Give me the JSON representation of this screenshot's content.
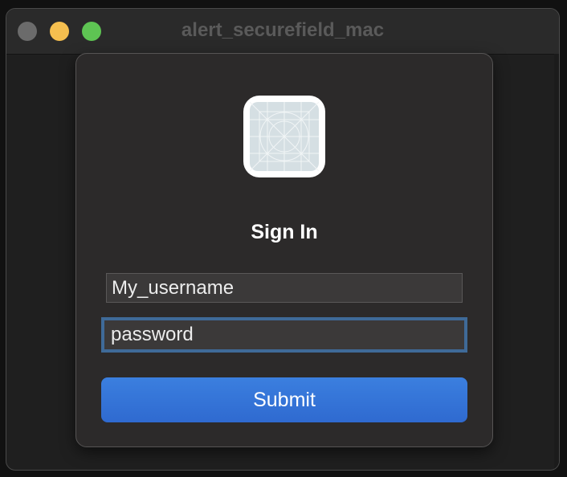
{
  "window": {
    "title": "alert_securefield_mac"
  },
  "alert": {
    "icon": "app-placeholder-icon",
    "title": "Sign In",
    "username_value": "My_username",
    "password_value": "password",
    "submit_label": "Submit"
  },
  "colors": {
    "accent": "#3b7fdf",
    "focus_ring": "#3f6a98"
  }
}
